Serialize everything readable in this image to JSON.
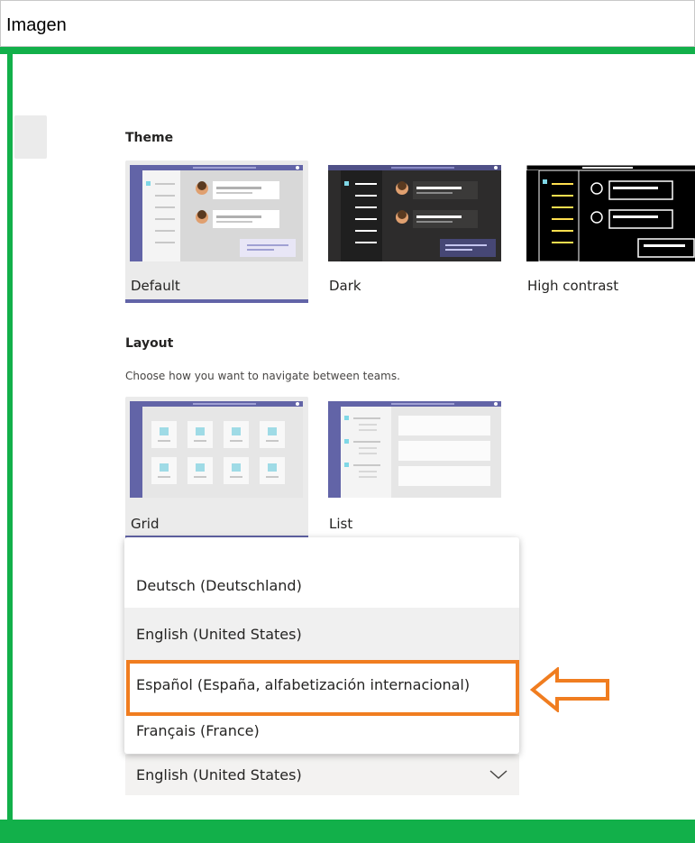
{
  "window": {
    "title": "Imagen"
  },
  "theme": {
    "heading": "Theme",
    "options": [
      {
        "label": "Default",
        "selected": true
      },
      {
        "label": "Dark",
        "selected": false
      },
      {
        "label": "High contrast",
        "selected": false
      }
    ]
  },
  "layout": {
    "heading": "Layout",
    "description": "Choose how you want to navigate between teams.",
    "options": [
      {
        "label": "Grid",
        "selected": true
      },
      {
        "label": "List",
        "selected": false
      }
    ]
  },
  "language": {
    "menu_items": [
      "Deutsch (Deutschland)",
      "English (United States)",
      "Español (España, alfabetización internacional)",
      "Français (France)"
    ],
    "hovered_item": "English (United States)",
    "highlighted_item": "Español (España, alfabetización internacional)",
    "selected_value": "English (United States)"
  },
  "colors": {
    "frame": "#12b04a",
    "accent": "#6264a7",
    "annotation": "#f07d20"
  }
}
